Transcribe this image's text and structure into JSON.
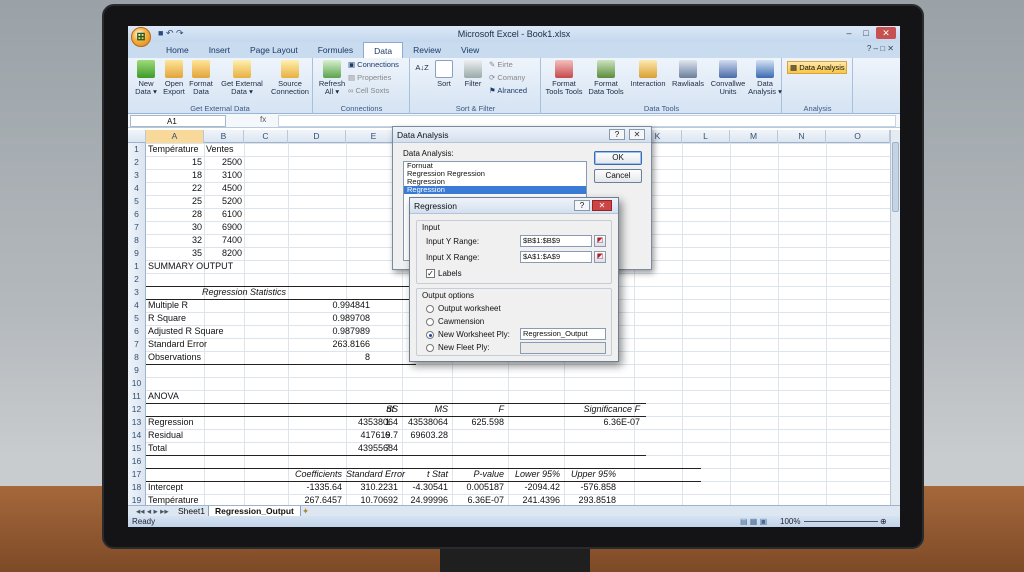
{
  "window": {
    "title": "Microsoft Excel - Book1.xlsx"
  },
  "tabs": [
    "Home",
    "Insert",
    "Page Layout",
    "Formules",
    "Data",
    "Review",
    "View"
  ],
  "ribbon": {
    "groups": {
      "get_external": "Get External Data",
      "connections": "Connections",
      "sort_filter": "Sort & Filter",
      "data_tools": "Data Tools",
      "analysis": "Analysis"
    },
    "new_data": "New\nData ▾",
    "open_export": "Open\nExport",
    "format_data": "Format\nData",
    "get_external_data": "Get External\nData ▾",
    "source_connection": "Source\nConnection",
    "refresh_all": "Refresh\nAll ▾",
    "connections": "Connections",
    "properties": "Properties",
    "cell_soxts": "Cell Soxts",
    "sort_az": "A↓Z",
    "sort": "Sort",
    "filter": "Filter",
    "eirte": "Eirte",
    "comany": "Comany",
    "alranced": "Alranced",
    "format_tools": "Format\nTools Tools",
    "format_data_tools": "Format\nData Tools",
    "interaction": "Interaction",
    "rawliaals": "Rawliaals",
    "convallwe_units": "Convallwe\nUnits",
    "data_analysis_btn": "Data\nAnalysis ▾",
    "data_analysis_small": "Data Analysis"
  },
  "formula_bar": {
    "namebox": "A1",
    "fx": "fx",
    "formula": ""
  },
  "columns": [
    "A",
    "B",
    "C",
    "D",
    "E",
    "F",
    "G",
    "H",
    "I",
    "J",
    "K",
    "L",
    "M",
    "N",
    "O"
  ],
  "rows_top": [
    {
      "n": "1",
      "a": "Température",
      "b": "Ventes"
    },
    {
      "n": "2",
      "a": "15",
      "b": "2500"
    },
    {
      "n": "3",
      "a": "18",
      "b": "3100"
    },
    {
      "n": "4",
      "a": "22",
      "b": "4500"
    },
    {
      "n": "5",
      "a": "25",
      "b": "5200"
    },
    {
      "n": "6",
      "a": "28",
      "b": "6100"
    },
    {
      "n": "7",
      "a": "30",
      "b": "6900"
    },
    {
      "n": "8",
      "a": "32",
      "b": "7400"
    },
    {
      "n": "9",
      "a": "35",
      "b": "8200"
    }
  ],
  "summary": {
    "title": "SUMMARY OUTPUT",
    "reg_stats_header": "Regression Statistics",
    "stats": [
      {
        "label": "Multiple R",
        "value": "0.994841"
      },
      {
        "label": "R Square",
        "value": "0.989708"
      },
      {
        "label": "Adjusted R Square",
        "value": "0.987989"
      },
      {
        "label": "Standard Error",
        "value": "263.8166"
      },
      {
        "label": "Observations",
        "value": "8"
      }
    ],
    "anova_title": "ANOVA",
    "anova_headers": [
      "df",
      "SS",
      "MS",
      "F",
      "Significance F"
    ],
    "anova_rows": [
      {
        "label": "Regression",
        "df": "1",
        "ss": "43538064",
        "ms": "43538064",
        "f": "625.598",
        "sig": "6.36E-07"
      },
      {
        "label": "Residual",
        "df": "6",
        "ss": "417619.7",
        "ms": "69603.28",
        "f": "",
        "sig": ""
      },
      {
        "label": "Total",
        "df": "7",
        "ss": "43955684",
        "ms": "",
        "f": "",
        "sig": ""
      }
    ],
    "coef_headers": [
      "Coefficients",
      "Standard Error",
      "t Stat",
      "P-value",
      "Lower 95%",
      "Upper 95%"
    ],
    "coef_rows": [
      {
        "label": "Intercept",
        "c": "-1335.64",
        "se": "310.2231",
        "t": "-4.30541",
        "p": "0.005187",
        "lo": "-2094.42",
        "hi": "-576.858"
      },
      {
        "label": "Température",
        "c": "267.6457",
        "se": "10.70692",
        "t": "24.99996",
        "p": "6.36E-07",
        "lo": "241.4396",
        "hi": "293.8518"
      }
    ],
    "row_numbers": [
      "1",
      "2",
      "3",
      "4",
      "5",
      "6",
      "7",
      "8",
      "9",
      "10",
      "11",
      "12",
      "13",
      "14",
      "15",
      "16",
      "17",
      "18",
      "19"
    ]
  },
  "sheet_tabs": [
    "Sheet1",
    "Regression_Output"
  ],
  "status": {
    "ready": "Ready",
    "zoom": "100%"
  },
  "data_analysis_dialog": {
    "title": "Data Analysis",
    "help": "?",
    "close": "✕",
    "label": "Data Analysis:",
    "items": [
      "Fornuat",
      "Regression Regression",
      "Regression",
      "Regression"
    ],
    "selected_index": 3,
    "ok": "OK",
    "cancel": "Cancel"
  },
  "regression_dialog": {
    "title": "Regression",
    "help": "?",
    "close": "✕",
    "input_label": "Input",
    "y_label": "Input Y Range:",
    "y_value": "$B$1:$B$9",
    "x_label": "Input X Range:",
    "x_value": "$A$1:$A$9",
    "labels": "Labels",
    "labels_checked": true,
    "output_label": "Output options",
    "opt_output_worksheet": "Output worksheet",
    "opt_cawmension": "Cawmension",
    "opt_new_worksheet": "New Worksheet Ply:",
    "new_worksheet_value": "Regression_Output",
    "opt_new_fleet": "New Fleet Ply:",
    "selected_option": "new_worksheet"
  }
}
